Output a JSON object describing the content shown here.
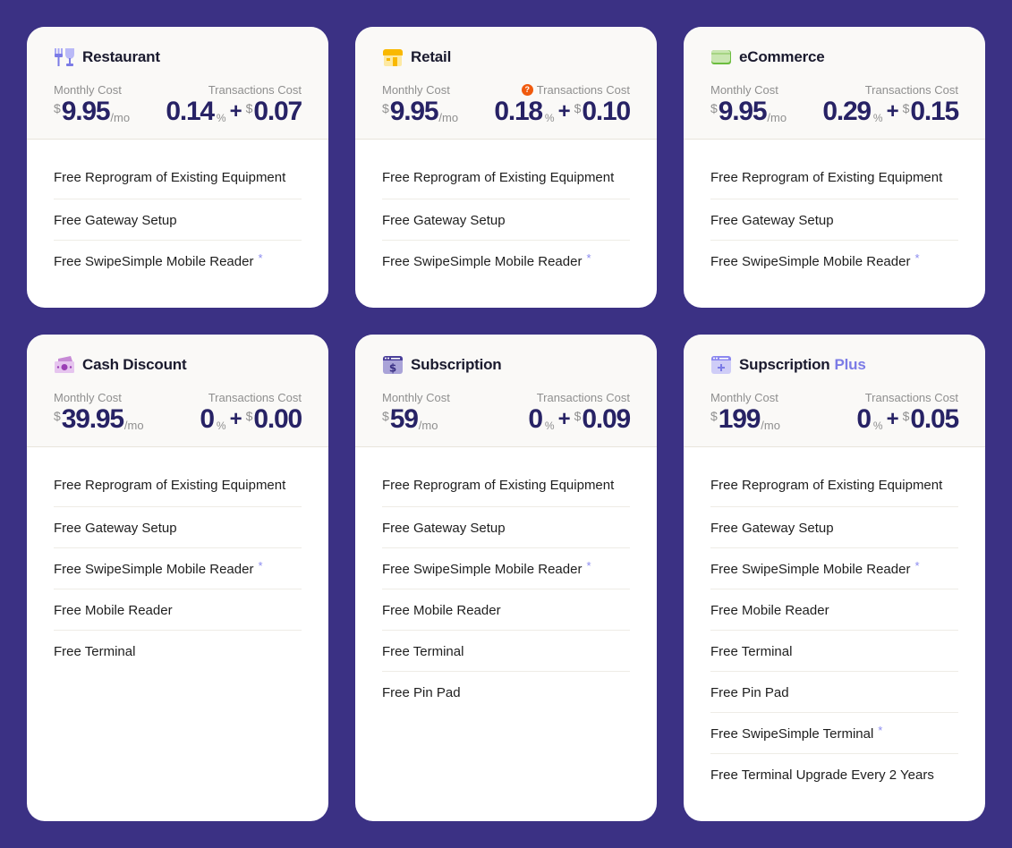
{
  "labels": {
    "monthly_cost": "Monthly Cost",
    "transactions_cost": "Transactions Cost",
    "currency": "$",
    "per_month": "/mo",
    "percent": "%",
    "plus": "+",
    "asterisk": "*",
    "help": "?"
  },
  "colors": {
    "background": "#3b3184",
    "price": "#272265",
    "accent": "#7b7be6",
    "help_badge": "#f05a0e"
  },
  "plans": [
    {
      "name": "Restaurant",
      "name_accent": "",
      "icon": "restaurant-icon",
      "monthly": "9.95",
      "rate": "0.14",
      "fee": "0.07",
      "has_help": false,
      "features": [
        {
          "text": "Free Reprogram of Existing Equipment",
          "star": false
        },
        {
          "text": "Free Gateway Setup",
          "star": false
        },
        {
          "text": "Free SwipeSimple Mobile Reader",
          "star": true
        }
      ]
    },
    {
      "name": "Retail",
      "name_accent": "",
      "icon": "store-icon",
      "monthly": "9.95",
      "rate": "0.18",
      "fee": "0.10",
      "has_help": true,
      "features": [
        {
          "text": "Free Reprogram of Existing Equipment",
          "star": false
        },
        {
          "text": "Free Gateway Setup",
          "star": false
        },
        {
          "text": "Free SwipeSimple Mobile Reader",
          "star": true
        }
      ]
    },
    {
      "name": "eCommerce",
      "name_accent": "",
      "icon": "credit-card-icon",
      "monthly": "9.95",
      "rate": "0.29",
      "fee": "0.15",
      "has_help": false,
      "features": [
        {
          "text": "Free Reprogram of Existing Equipment",
          "star": false
        },
        {
          "text": "Free Gateway Setup",
          "star": false
        },
        {
          "text": "Free SwipeSimple Mobile Reader",
          "star": true
        }
      ]
    },
    {
      "name": "Cash Discount",
      "name_accent": "",
      "icon": "cash-icon",
      "monthly": "39.95",
      "rate": "0",
      "fee": "0.00",
      "has_help": false,
      "features": [
        {
          "text": "Free Reprogram of Existing Equipment",
          "star": false
        },
        {
          "text": "Free Gateway Setup",
          "star": false
        },
        {
          "text": "Free SwipeSimple Mobile Reader",
          "star": true
        },
        {
          "text": "Free Mobile Reader",
          "star": false
        },
        {
          "text": "Free Terminal",
          "star": false
        }
      ]
    },
    {
      "name": "Subscription",
      "name_accent": "",
      "icon": "subscription-icon",
      "monthly": "59",
      "rate": "0",
      "fee": "0.09",
      "has_help": false,
      "features": [
        {
          "text": "Free Reprogram of Existing Equipment",
          "star": false
        },
        {
          "text": "Free Gateway Setup",
          "star": false
        },
        {
          "text": "Free SwipeSimple Mobile Reader",
          "star": true
        },
        {
          "text": "Free Mobile Reader",
          "star": false
        },
        {
          "text": "Free Terminal",
          "star": false
        },
        {
          "text": "Free Pin Pad",
          "star": false
        }
      ]
    },
    {
      "name": "Supscription",
      "name_accent": "Plus",
      "icon": "subscription-plus-icon",
      "monthly": "199",
      "rate": "0",
      "fee": "0.05",
      "has_help": false,
      "features": [
        {
          "text": "Free Reprogram of Existing Equipment",
          "star": false
        },
        {
          "text": "Free Gateway Setup",
          "star": false
        },
        {
          "text": "Free SwipeSimple Mobile Reader",
          "star": true
        },
        {
          "text": "Free Mobile Reader",
          "star": false
        },
        {
          "text": "Free Terminal",
          "star": false
        },
        {
          "text": "Free Pin Pad",
          "star": false
        },
        {
          "text": "Free SwipeSimple Terminal",
          "star": true
        },
        {
          "text": "Free Terminal Upgrade Every 2 Years",
          "star": false
        }
      ]
    }
  ]
}
